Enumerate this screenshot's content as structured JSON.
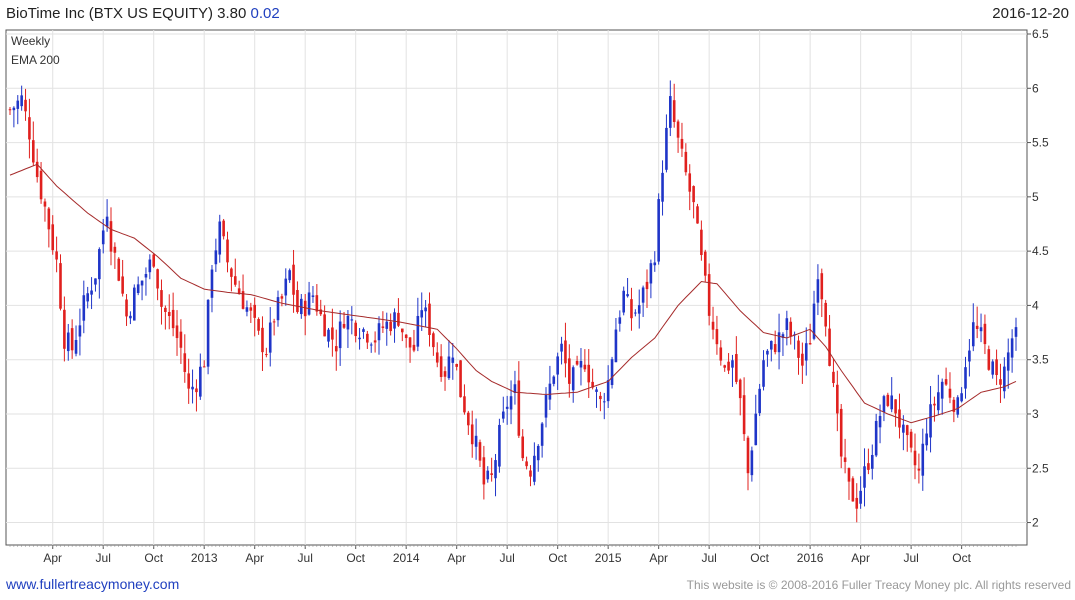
{
  "header": {
    "title": "BioTime Inc (BTX US EQUITY) 3.80",
    "change": "0.02",
    "date": "2016-12-20"
  },
  "footer": {
    "link": "www.fullertreacymoney.com",
    "copyright": "This website is © 2008-2016 Fuller Treacy Money plc. All rights reserved"
  },
  "colors": {
    "up": "#1f35c8",
    "down": "#e0201e",
    "ema": "#a52a2a",
    "grid": "#e2e2e2"
  },
  "chart_data": {
    "type": "candlestick",
    "legend": [
      "Weekly",
      "EMA 200"
    ],
    "legend_position": "top-left",
    "grid": true,
    "y_axis": {
      "side": "right",
      "ylim": [
        1.9,
        6.5
      ],
      "ticks": [
        "6.5",
        "6",
        "5.5",
        "5",
        "4.5",
        "4",
        "3.5",
        "3",
        "2.5",
        "2"
      ]
    },
    "x_ticks": [
      {
        "week": 11,
        "label": "Apr"
      },
      {
        "week": 24,
        "label": "Jul"
      },
      {
        "week": 37,
        "label": "Oct"
      },
      {
        "week": 50,
        "label": "2013"
      },
      {
        "week": 63,
        "label": "Apr"
      },
      {
        "week": 76,
        "label": "Jul"
      },
      {
        "week": 89,
        "label": "Oct"
      },
      {
        "week": 102,
        "label": "2014"
      },
      {
        "week": 115,
        "label": "Apr"
      },
      {
        "week": 128,
        "label": "Jul"
      },
      {
        "week": 141,
        "label": "Oct"
      },
      {
        "week": 154,
        "label": "2015"
      },
      {
        "week": 167,
        "label": "Apr"
      },
      {
        "week": 180,
        "label": "Jul"
      },
      {
        "week": 193,
        "label": "Oct"
      },
      {
        "week": 206,
        "label": "2016"
      },
      {
        "week": 219,
        "label": "Apr"
      },
      {
        "week": 232,
        "label": "Jul"
      },
      {
        "week": 245,
        "label": "Oct"
      }
    ],
    "weeks_total": 260,
    "last_close": 3.8,
    "close_anchors": [
      [
        0,
        5.8
      ],
      [
        3,
        5.9
      ],
      [
        5,
        5.6
      ],
      [
        7,
        5.2
      ],
      [
        9,
        4.9
      ],
      [
        12,
        4.4
      ],
      [
        14,
        3.7
      ],
      [
        16,
        3.6
      ],
      [
        19,
        4.0
      ],
      [
        22,
        4.3
      ],
      [
        25,
        4.9
      ],
      [
        26,
        4.6
      ],
      [
        28,
        4.3
      ],
      [
        30,
        3.9
      ],
      [
        32,
        4.1
      ],
      [
        35,
        4.3
      ],
      [
        37,
        4.45
      ],
      [
        39,
        4.0
      ],
      [
        42,
        3.8
      ],
      [
        44,
        3.6
      ],
      [
        46,
        3.2
      ],
      [
        48,
        3.3
      ],
      [
        50,
        3.5
      ],
      [
        52,
        4.4
      ],
      [
        54,
        4.7
      ],
      [
        56,
        4.4
      ],
      [
        58,
        4.2
      ],
      [
        60,
        4.05
      ],
      [
        62,
        3.9
      ],
      [
        64,
        3.7
      ],
      [
        66,
        3.6
      ],
      [
        68,
        3.9
      ],
      [
        70,
        4.05
      ],
      [
        72,
        4.3
      ],
      [
        74,
        3.95
      ],
      [
        76,
        4.0
      ],
      [
        78,
        4.1
      ],
      [
        80,
        3.9
      ],
      [
        82,
        3.75
      ],
      [
        84,
        3.65
      ],
      [
        86,
        3.9
      ],
      [
        88,
        3.85
      ],
      [
        90,
        3.8
      ],
      [
        92,
        3.75
      ],
      [
        94,
        3.7
      ],
      [
        96,
        3.8
      ],
      [
        98,
        3.85
      ],
      [
        100,
        3.9
      ],
      [
        102,
        3.65
      ],
      [
        104,
        3.6
      ],
      [
        106,
        4.0
      ],
      [
        108,
        3.8
      ],
      [
        110,
        3.5
      ],
      [
        112,
        3.4
      ],
      [
        114,
        3.6
      ],
      [
        116,
        3.2
      ],
      [
        118,
        2.95
      ],
      [
        120,
        2.7
      ],
      [
        122,
        2.35
      ],
      [
        124,
        2.4
      ],
      [
        126,
        2.8
      ],
      [
        128,
        3.1
      ],
      [
        130,
        3.2
      ],
      [
        132,
        2.6
      ],
      [
        134,
        2.5
      ],
      [
        136,
        2.8
      ],
      [
        138,
        3.1
      ],
      [
        140,
        3.4
      ],
      [
        142,
        3.6
      ],
      [
        144,
        3.3
      ],
      [
        146,
        3.35
      ],
      [
        148,
        3.5
      ],
      [
        150,
        3.25
      ],
      [
        152,
        3.1
      ],
      [
        154,
        3.3
      ],
      [
        156,
        3.8
      ],
      [
        158,
        4.1
      ],
      [
        160,
        3.9
      ],
      [
        162,
        4.0
      ],
      [
        164,
        4.2
      ],
      [
        166,
        4.5
      ],
      [
        168,
        5.3
      ],
      [
        170,
        5.85
      ],
      [
        172,
        5.5
      ],
      [
        174,
        5.2
      ],
      [
        176,
        4.9
      ],
      [
        178,
        4.4
      ],
      [
        180,
        3.95
      ],
      [
        182,
        3.7
      ],
      [
        184,
        3.4
      ],
      [
        186,
        3.5
      ],
      [
        188,
        3.1
      ],
      [
        190,
        2.45
      ],
      [
        192,
        3.0
      ],
      [
        194,
        3.5
      ],
      [
        196,
        3.6
      ],
      [
        198,
        3.7
      ],
      [
        200,
        3.8
      ],
      [
        202,
        3.65
      ],
      [
        204,
        3.45
      ],
      [
        206,
        3.7
      ],
      [
        208,
        4.35
      ],
      [
        210,
        3.9
      ],
      [
        212,
        3.2
      ],
      [
        214,
        2.6
      ],
      [
        216,
        2.3
      ],
      [
        218,
        2.2
      ],
      [
        220,
        2.45
      ],
      [
        222,
        2.7
      ],
      [
        224,
        3.0
      ],
      [
        226,
        3.15
      ],
      [
        228,
        3.05
      ],
      [
        230,
        2.8
      ],
      [
        232,
        2.6
      ],
      [
        234,
        2.45
      ],
      [
        236,
        2.9
      ],
      [
        238,
        3.1
      ],
      [
        240,
        3.3
      ],
      [
        242,
        3.2
      ],
      [
        244,
        3.05
      ],
      [
        246,
        3.5
      ],
      [
        248,
        3.8
      ],
      [
        250,
        3.7
      ],
      [
        252,
        3.5
      ],
      [
        254,
        3.3
      ],
      [
        256,
        3.4
      ],
      [
        258,
        3.7
      ],
      [
        259,
        3.8
      ]
    ],
    "ema_anchors": [
      [
        0,
        5.2
      ],
      [
        7,
        5.3
      ],
      [
        12,
        5.1
      ],
      [
        20,
        4.85
      ],
      [
        26,
        4.7
      ],
      [
        32,
        4.62
      ],
      [
        38,
        4.45
      ],
      [
        44,
        4.25
      ],
      [
        50,
        4.15
      ],
      [
        56,
        4.12
      ],
      [
        62,
        4.1
      ],
      [
        70,
        4.02
      ],
      [
        80,
        3.95
      ],
      [
        90,
        3.9
      ],
      [
        100,
        3.85
      ],
      [
        110,
        3.78
      ],
      [
        115,
        3.6
      ],
      [
        120,
        3.4
      ],
      [
        124,
        3.3
      ],
      [
        130,
        3.2
      ],
      [
        138,
        3.18
      ],
      [
        146,
        3.2
      ],
      [
        154,
        3.3
      ],
      [
        160,
        3.52
      ],
      [
        166,
        3.7
      ],
      [
        172,
        4.0
      ],
      [
        178,
        4.22
      ],
      [
        182,
        4.2
      ],
      [
        188,
        3.95
      ],
      [
        194,
        3.75
      ],
      [
        200,
        3.7
      ],
      [
        206,
        3.78
      ],
      [
        210,
        3.62
      ],
      [
        214,
        3.4
      ],
      [
        220,
        3.1
      ],
      [
        226,
        3.0
      ],
      [
        232,
        2.92
      ],
      [
        238,
        2.98
      ],
      [
        244,
        3.05
      ],
      [
        250,
        3.2
      ],
      [
        256,
        3.25
      ],
      [
        259,
        3.3
      ]
    ]
  }
}
